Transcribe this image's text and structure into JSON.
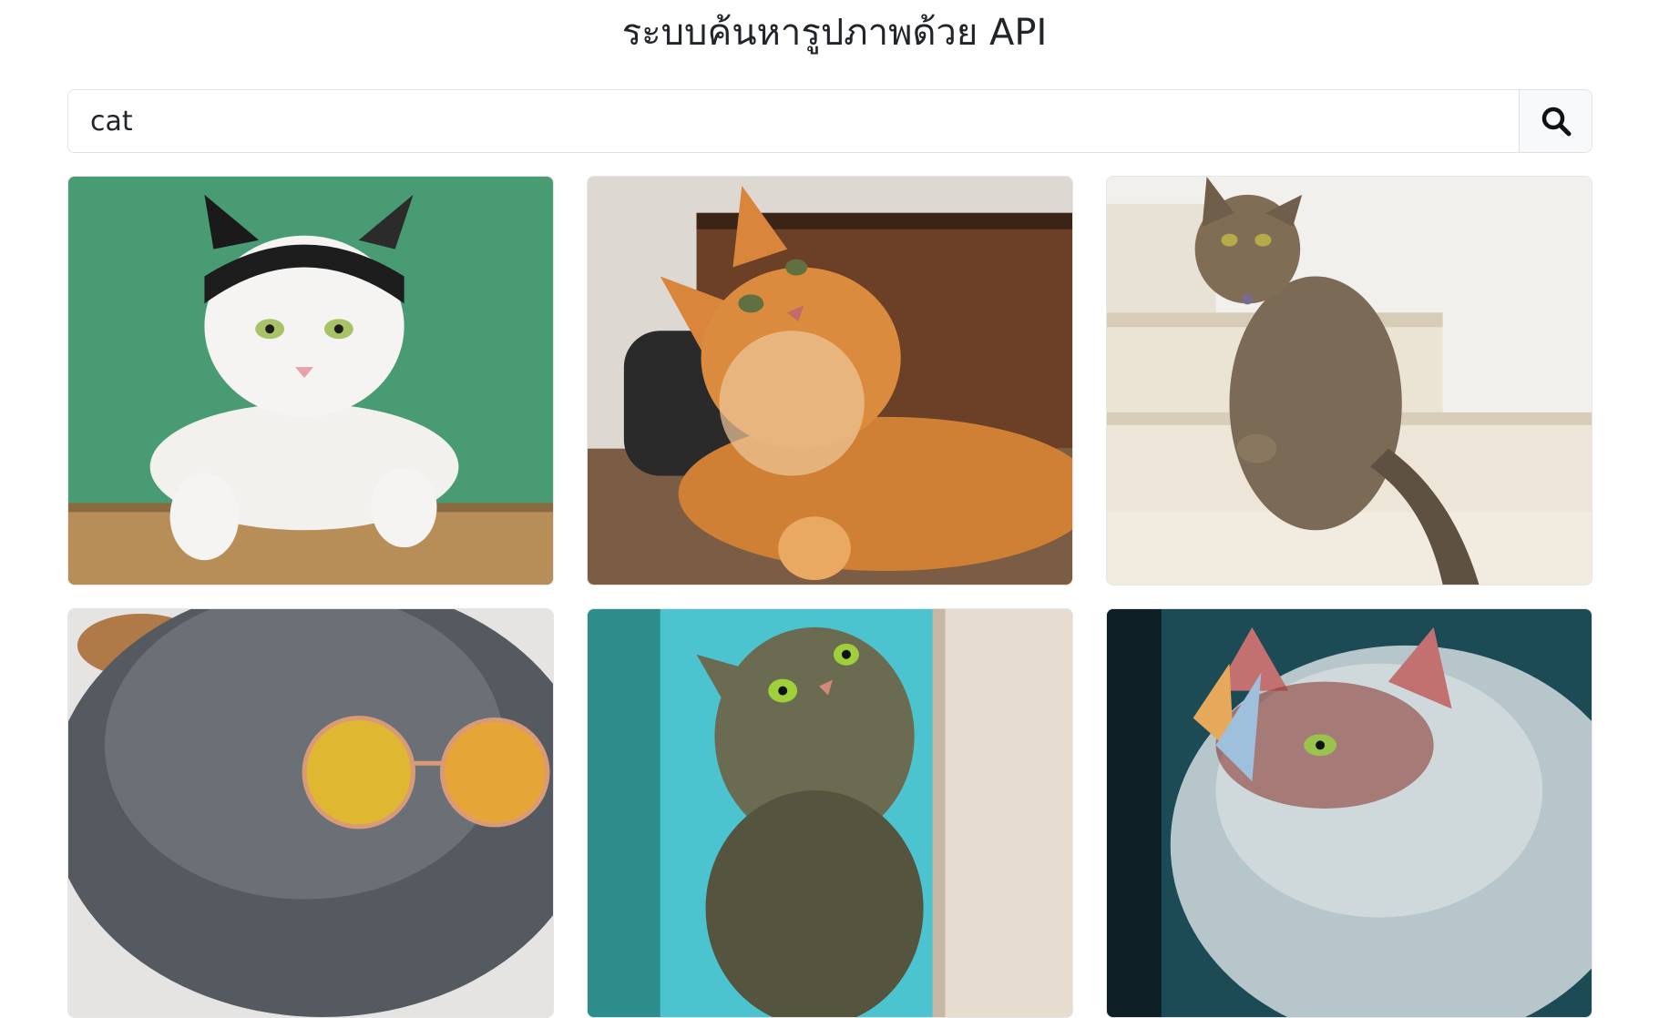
{
  "page": {
    "title": "ระบบค้นหารูปภาพด้วย API"
  },
  "search": {
    "value": "cat",
    "placeholder": "",
    "icon": "search-icon"
  },
  "results": [
    {
      "subject": "black-and-white cat on green background",
      "bg": "#4ea27a"
    },
    {
      "subject": "orange tabby cat lying on wooden floor",
      "bg": "#6b4a32"
    },
    {
      "subject": "tabby cat sitting on cream stairs",
      "bg": "#f2f0ec"
    },
    {
      "subject": "gray cat wearing round sunglasses",
      "bg": "#d9d9d9"
    },
    {
      "subject": "tabby cat peeking around a corner",
      "bg": "#4cc4cf"
    },
    {
      "subject": "cat with butterfly on nose",
      "bg": "#1c4a55"
    }
  ]
}
